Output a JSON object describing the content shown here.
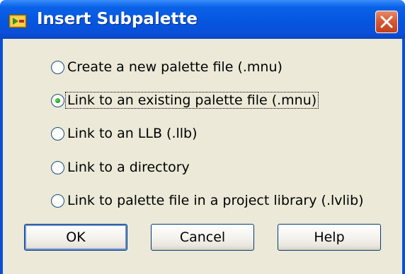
{
  "dialog": {
    "title": "Insert Subpalette",
    "app_icon": "labview-icon",
    "close_icon": "close-icon"
  },
  "options": [
    {
      "label": "Create a new palette file (.mnu)",
      "selected": false
    },
    {
      "label": "Link to an existing palette file (.mnu)",
      "selected": true
    },
    {
      "label": "Link to an LLB (.llb)",
      "selected": false
    },
    {
      "label": "Link to a directory",
      "selected": false
    },
    {
      "label": "Link to palette file in a project library (.lvlib)",
      "selected": false
    }
  ],
  "buttons": {
    "ok": "OK",
    "cancel": "Cancel",
    "help": "Help"
  },
  "colors": {
    "titlebar": "#0a4fd8",
    "client": "#ece9d8",
    "close": "#d85a34",
    "radio_dot": "#21a121"
  }
}
